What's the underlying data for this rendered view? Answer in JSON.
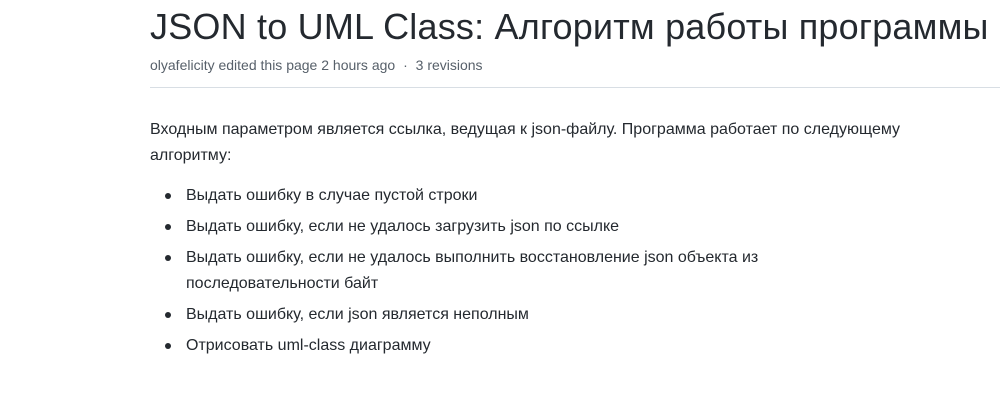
{
  "header": {
    "title": "JSON to UML Class: Алгоритм работы программы",
    "author": "olyafelicity",
    "edit_text": "edited this page 2 hours ago",
    "separator": "·",
    "revisions": "3 revisions"
  },
  "content": {
    "intro": "Входным параметром является ссылка, ведущая к json-файлу. Программа работает по следующему алгоритму:",
    "steps": [
      "Выдать ошибку в случае пустой строки",
      "Выдать ошибку, если не удалось загрузить json по ссылке",
      "Выдать ошибку, если не удалось выполнить восстановление json объекта из последовательности байт",
      "Выдать ошибку, если json является неполным",
      "Отрисовать uml-class диаграмму"
    ]
  }
}
